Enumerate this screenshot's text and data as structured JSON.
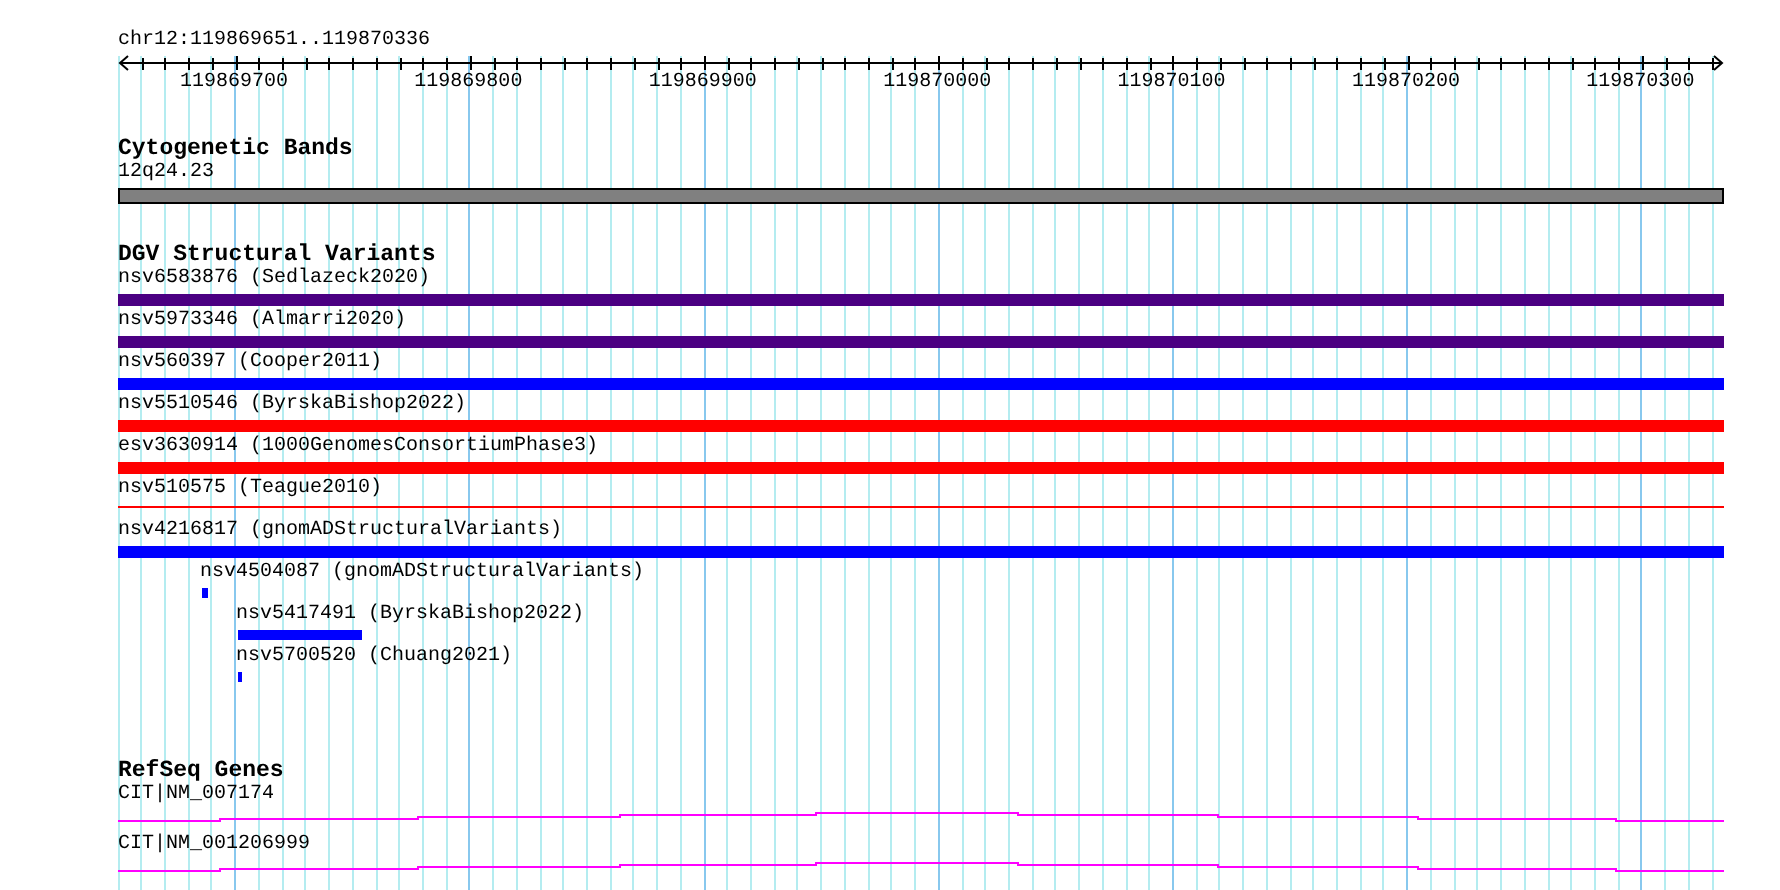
{
  "location": "chr12:119869651..119870336",
  "ruler": {
    "labels": [
      "119869700",
      "119869800",
      "119869900",
      "119870000",
      "119870100",
      "119870200",
      "119870300"
    ]
  },
  "tracks": [
    {
      "kind": "bands",
      "title": "Cytogenetic Bands",
      "features": [
        {
          "label": "12q24.23",
          "color": "#808080"
        }
      ]
    },
    {
      "kind": "variants",
      "title": "DGV Structural Variants",
      "features": [
        {
          "label": "nsv6583876 (Sedlazeck2020)",
          "kind": "bar",
          "color": "#4b0082"
        },
        {
          "label": "nsv5973346 (Almarri2020)",
          "kind": "bar",
          "color": "#4b0082"
        },
        {
          "label": "nsv560397 (Cooper2011)",
          "kind": "bar",
          "color": "#0000ff"
        },
        {
          "label": "nsv5510546 (ByrskaBishop2022)",
          "kind": "bar",
          "color": "#ff0000"
        },
        {
          "label": "esv3630914 (1000GenomesConsortiumPhase3)",
          "kind": "bar",
          "color": "#ff0000"
        },
        {
          "label": "nsv510575 (Teague2010)",
          "kind": "thin",
          "color": "#ff0000"
        },
        {
          "label": "nsv4216817 (gnomADStructuralVariants)",
          "kind": "bar",
          "color": "#0000ff"
        },
        {
          "label": "nsv4504087 (gnomADStructuralVariants)",
          "kind": "bar",
          "color": "#0000ff"
        },
        {
          "label": "nsv5417491 (ByrskaBishop2022)",
          "kind": "bar",
          "color": "#0000ff"
        },
        {
          "label": "nsv5700520 (Chuang2021)",
          "kind": "bar",
          "color": "#0000ff"
        }
      ]
    },
    {
      "kind": "genes",
      "title": "RefSeq Genes",
      "features": [
        {
          "label": "CIT|NM_007174",
          "color": "#ff00ff"
        },
        {
          "label": "CIT|NM_001206999",
          "color": "#ff00ff"
        }
      ]
    }
  ]
}
